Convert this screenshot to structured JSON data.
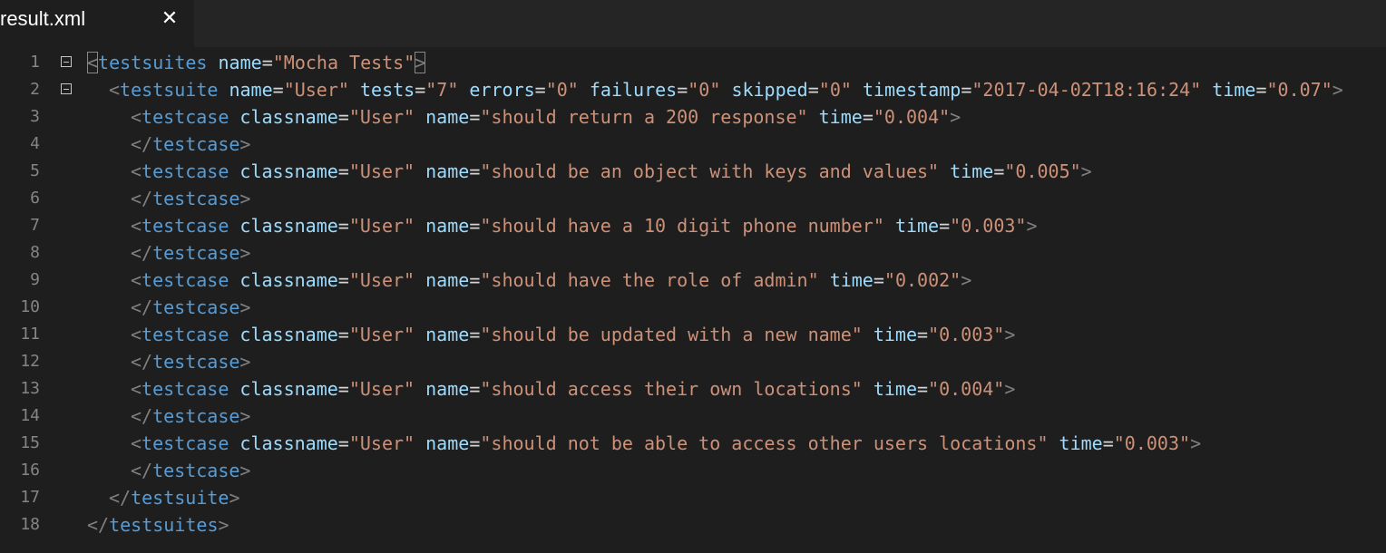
{
  "tab": {
    "title": "result.xml",
    "close_glyph": "✕"
  },
  "editor": {
    "lines": [
      {
        "num": "1",
        "fold": true,
        "tokens": [
          [
            "p",
            "<"
          ],
          [
            "t",
            "testsuites"
          ],
          [
            "e",
            " "
          ],
          [
            "a",
            "name"
          ],
          [
            "e",
            "="
          ],
          [
            "v",
            "\"Mocha Tests\""
          ],
          [
            "p",
            ">"
          ]
        ]
      },
      {
        "num": "2",
        "fold": true,
        "tokens": [
          [
            "p",
            "<"
          ],
          [
            "t",
            "testsuite"
          ],
          [
            "e",
            " "
          ],
          [
            "a",
            "name"
          ],
          [
            "e",
            "="
          ],
          [
            "v",
            "\"User\""
          ],
          [
            "e",
            " "
          ],
          [
            "a",
            "tests"
          ],
          [
            "e",
            "="
          ],
          [
            "v",
            "\"7\""
          ],
          [
            "e",
            " "
          ],
          [
            "a",
            "errors"
          ],
          [
            "e",
            "="
          ],
          [
            "v",
            "\"0\""
          ],
          [
            "e",
            " "
          ],
          [
            "a",
            "failures"
          ],
          [
            "e",
            "="
          ],
          [
            "v",
            "\"0\""
          ],
          [
            "e",
            " "
          ],
          [
            "a",
            "skipped"
          ],
          [
            "e",
            "="
          ],
          [
            "v",
            "\"0\""
          ],
          [
            "e",
            " "
          ],
          [
            "a",
            "timestamp"
          ],
          [
            "e",
            "="
          ],
          [
            "v",
            "\"2017-04-02T18:16:24\""
          ],
          [
            "e",
            " "
          ],
          [
            "a",
            "time"
          ],
          [
            "e",
            "="
          ],
          [
            "v",
            "\"0.07\""
          ],
          [
            "p",
            ">"
          ]
        ]
      },
      {
        "num": "3",
        "tokens": [
          [
            "p",
            "<"
          ],
          [
            "t",
            "testcase"
          ],
          [
            "e",
            " "
          ],
          [
            "a",
            "classname"
          ],
          [
            "e",
            "="
          ],
          [
            "v",
            "\"User\""
          ],
          [
            "e",
            " "
          ],
          [
            "a",
            "name"
          ],
          [
            "e",
            "="
          ],
          [
            "v",
            "\"should return a 200 response\""
          ],
          [
            "e",
            " "
          ],
          [
            "a",
            "time"
          ],
          [
            "e",
            "="
          ],
          [
            "v",
            "\"0.004\""
          ],
          [
            "p",
            ">"
          ]
        ]
      },
      {
        "num": "4",
        "tokens": [
          [
            "p",
            "</"
          ],
          [
            "t",
            "testcase"
          ],
          [
            "p",
            ">"
          ]
        ]
      },
      {
        "num": "5",
        "tokens": [
          [
            "p",
            "<"
          ],
          [
            "t",
            "testcase"
          ],
          [
            "e",
            " "
          ],
          [
            "a",
            "classname"
          ],
          [
            "e",
            "="
          ],
          [
            "v",
            "\"User\""
          ],
          [
            "e",
            " "
          ],
          [
            "a",
            "name"
          ],
          [
            "e",
            "="
          ],
          [
            "v",
            "\"should be an object with keys and values\""
          ],
          [
            "e",
            " "
          ],
          [
            "a",
            "time"
          ],
          [
            "e",
            "="
          ],
          [
            "v",
            "\"0.005\""
          ],
          [
            "p",
            ">"
          ]
        ]
      },
      {
        "num": "6",
        "tokens": [
          [
            "p",
            "</"
          ],
          [
            "t",
            "testcase"
          ],
          [
            "p",
            ">"
          ]
        ]
      },
      {
        "num": "7",
        "tokens": [
          [
            "p",
            "<"
          ],
          [
            "t",
            "testcase"
          ],
          [
            "e",
            " "
          ],
          [
            "a",
            "classname"
          ],
          [
            "e",
            "="
          ],
          [
            "v",
            "\"User\""
          ],
          [
            "e",
            " "
          ],
          [
            "a",
            "name"
          ],
          [
            "e",
            "="
          ],
          [
            "v",
            "\"should have a 10 digit phone number\""
          ],
          [
            "e",
            " "
          ],
          [
            "a",
            "time"
          ],
          [
            "e",
            "="
          ],
          [
            "v",
            "\"0.003\""
          ],
          [
            "p",
            ">"
          ]
        ]
      },
      {
        "num": "8",
        "tokens": [
          [
            "p",
            "</"
          ],
          [
            "t",
            "testcase"
          ],
          [
            "p",
            ">"
          ]
        ]
      },
      {
        "num": "9",
        "tokens": [
          [
            "p",
            "<"
          ],
          [
            "t",
            "testcase"
          ],
          [
            "e",
            " "
          ],
          [
            "a",
            "classname"
          ],
          [
            "e",
            "="
          ],
          [
            "v",
            "\"User\""
          ],
          [
            "e",
            " "
          ],
          [
            "a",
            "name"
          ],
          [
            "e",
            "="
          ],
          [
            "v",
            "\"should have the role of admin\""
          ],
          [
            "e",
            " "
          ],
          [
            "a",
            "time"
          ],
          [
            "e",
            "="
          ],
          [
            "v",
            "\"0.002\""
          ],
          [
            "p",
            ">"
          ]
        ]
      },
      {
        "num": "10",
        "tokens": [
          [
            "p",
            "</"
          ],
          [
            "t",
            "testcase"
          ],
          [
            "p",
            ">"
          ]
        ]
      },
      {
        "num": "11",
        "tokens": [
          [
            "p",
            "<"
          ],
          [
            "t",
            "testcase"
          ],
          [
            "e",
            " "
          ],
          [
            "a",
            "classname"
          ],
          [
            "e",
            "="
          ],
          [
            "v",
            "\"User\""
          ],
          [
            "e",
            " "
          ],
          [
            "a",
            "name"
          ],
          [
            "e",
            "="
          ],
          [
            "v",
            "\"should be updated with a new name\""
          ],
          [
            "e",
            " "
          ],
          [
            "a",
            "time"
          ],
          [
            "e",
            "="
          ],
          [
            "v",
            "\"0.003\""
          ],
          [
            "p",
            ">"
          ]
        ]
      },
      {
        "num": "12",
        "tokens": [
          [
            "p",
            "</"
          ],
          [
            "t",
            "testcase"
          ],
          [
            "p",
            ">"
          ]
        ]
      },
      {
        "num": "13",
        "tokens": [
          [
            "p",
            "<"
          ],
          [
            "t",
            "testcase"
          ],
          [
            "e",
            " "
          ],
          [
            "a",
            "classname"
          ],
          [
            "e",
            "="
          ],
          [
            "v",
            "\"User\""
          ],
          [
            "e",
            " "
          ],
          [
            "a",
            "name"
          ],
          [
            "e",
            "="
          ],
          [
            "v",
            "\"should access their own locations\""
          ],
          [
            "e",
            " "
          ],
          [
            "a",
            "time"
          ],
          [
            "e",
            "="
          ],
          [
            "v",
            "\"0.004\""
          ],
          [
            "p",
            ">"
          ]
        ]
      },
      {
        "num": "14",
        "tokens": [
          [
            "p",
            "</"
          ],
          [
            "t",
            "testcase"
          ],
          [
            "p",
            ">"
          ]
        ]
      },
      {
        "num": "15",
        "tokens": [
          [
            "p",
            "<"
          ],
          [
            "t",
            "testcase"
          ],
          [
            "e",
            " "
          ],
          [
            "a",
            "classname"
          ],
          [
            "e",
            "="
          ],
          [
            "v",
            "\"User\""
          ],
          [
            "e",
            " "
          ],
          [
            "a",
            "name"
          ],
          [
            "e",
            "="
          ],
          [
            "v",
            "\"should not be able to access other users locations\""
          ],
          [
            "e",
            " "
          ],
          [
            "a",
            "time"
          ],
          [
            "e",
            "="
          ],
          [
            "v",
            "\"0.003\""
          ],
          [
            "p",
            ">"
          ]
        ]
      },
      {
        "num": "16",
        "tokens": [
          [
            "p",
            "</"
          ],
          [
            "t",
            "testcase"
          ],
          [
            "p",
            ">"
          ]
        ]
      },
      {
        "num": "17",
        "tokens": [
          [
            "p",
            "</"
          ],
          [
            "t",
            "testsuite"
          ],
          [
            "p",
            ">"
          ]
        ]
      },
      {
        "num": "18",
        "tokens": [
          [
            "p",
            "</"
          ],
          [
            "t",
            "testsuites"
          ],
          [
            "p",
            ">"
          ]
        ]
      }
    ]
  },
  "colors": {
    "background": "#1e1e1e",
    "tag": "#569cd6",
    "attribute": "#9cdcfe",
    "string": "#ce9178",
    "punctuation": "#808080",
    "line_number": "#858585"
  }
}
